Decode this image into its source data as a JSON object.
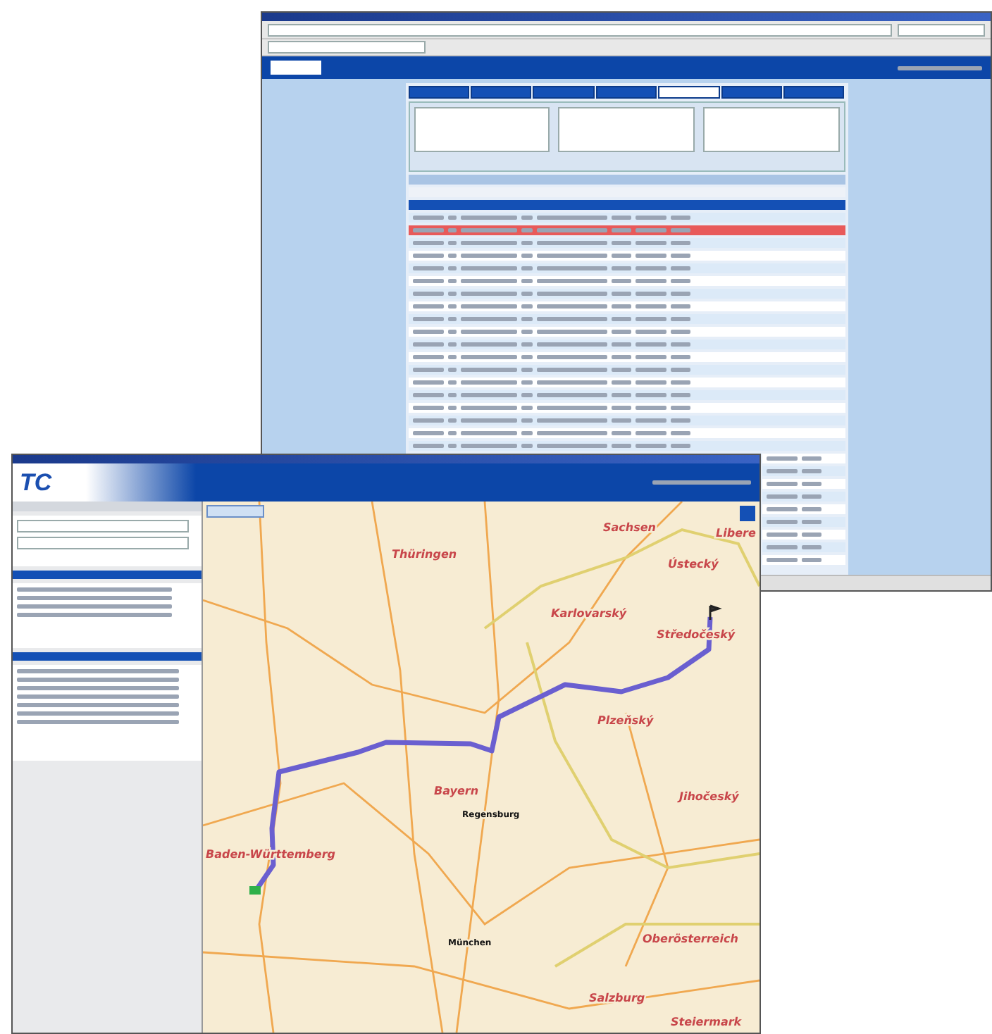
{
  "back_window": {
    "nav_tabs": [
      {
        "selected": false
      },
      {
        "selected": false
      },
      {
        "selected": false
      },
      {
        "selected": false
      },
      {
        "selected": true
      },
      {
        "selected": false
      },
      {
        "selected": false
      }
    ],
    "table": {
      "rows": [
        {
          "selected": false
        },
        {
          "selected": true
        },
        {
          "selected": false
        },
        {
          "selected": false
        },
        {
          "selected": false
        },
        {
          "selected": false
        },
        {
          "selected": false
        },
        {
          "selected": false
        },
        {
          "selected": false
        },
        {
          "selected": false
        },
        {
          "selected": false
        },
        {
          "selected": false
        },
        {
          "selected": false
        },
        {
          "selected": false
        },
        {
          "selected": false
        },
        {
          "selected": false
        },
        {
          "selected": false
        },
        {
          "selected": false
        },
        {
          "selected": false
        },
        {
          "selected": false
        },
        {
          "selected": false
        },
        {
          "selected": false
        },
        {
          "selected": false
        },
        {
          "selected": false
        },
        {
          "selected": false
        },
        {
          "selected": false
        },
        {
          "selected": false
        },
        {
          "selected": false
        }
      ]
    }
  },
  "front_window": {
    "logo": "TC",
    "map": {
      "labels": [
        {
          "text": "Sachsen",
          "kind": "region"
        },
        {
          "text": "Thüringen",
          "kind": "region"
        },
        {
          "text": "Libere",
          "kind": "region"
        },
        {
          "text": "Ústecký",
          "kind": "region"
        },
        {
          "text": "Karlovarský",
          "kind": "region"
        },
        {
          "text": "Středočeský",
          "kind": "region"
        },
        {
          "text": "Plzeňský",
          "kind": "region"
        },
        {
          "text": "Bayern",
          "kind": "region"
        },
        {
          "text": "Jihočeský",
          "kind": "region"
        },
        {
          "text": "Baden-Württemberg",
          "kind": "region"
        },
        {
          "text": "Regensburg",
          "kind": "city"
        },
        {
          "text": "München",
          "kind": "city"
        },
        {
          "text": "Oberösterreich",
          "kind": "region"
        },
        {
          "text": "Salzburg",
          "kind": "region"
        },
        {
          "text": "Steiermark",
          "kind": "region"
        }
      ]
    }
  }
}
